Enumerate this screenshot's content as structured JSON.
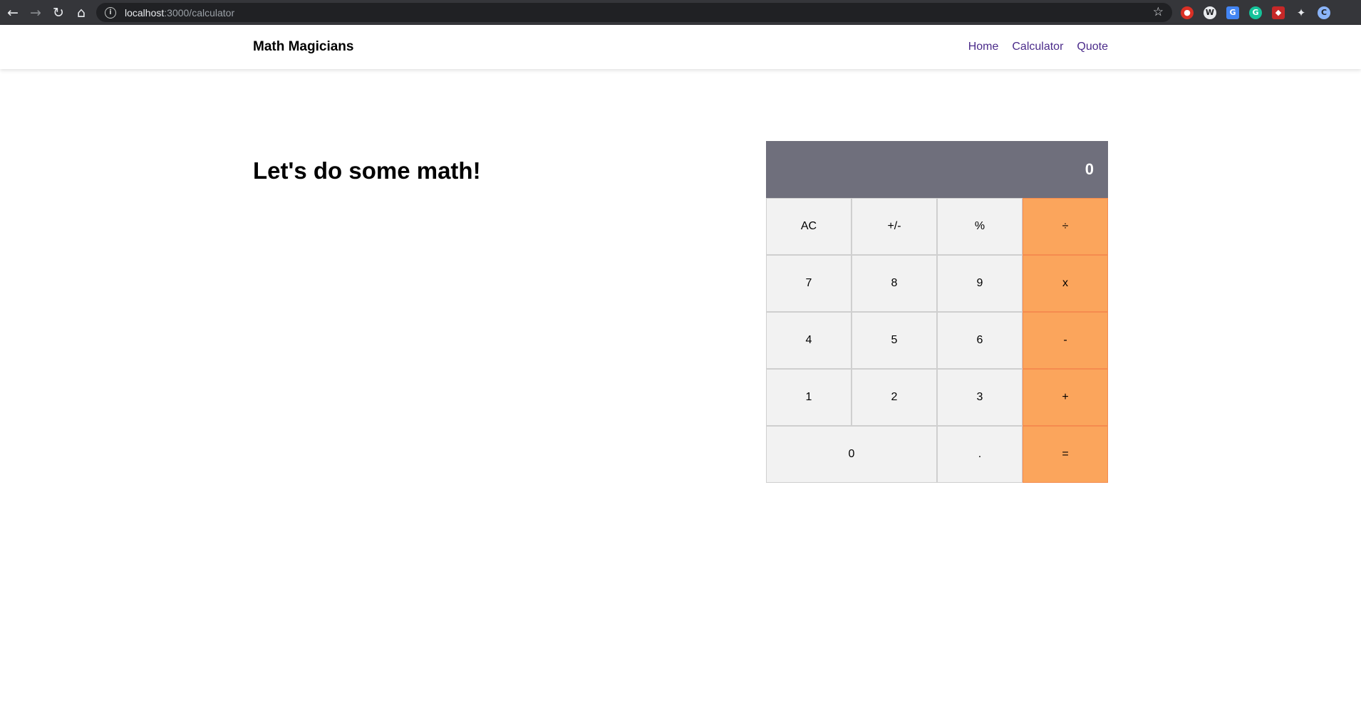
{
  "browser": {
    "url_host": "localhost",
    "url_path": ":3000/calculator"
  },
  "navbar": {
    "brand": "Math Magicians",
    "links": [
      "Home",
      "Calculator",
      "Quote"
    ]
  },
  "main": {
    "heading": "Let's do some math!"
  },
  "calculator": {
    "display": "0",
    "keys": [
      "AC",
      "+/-",
      "%",
      "÷",
      "7",
      "8",
      "9",
      "x",
      "4",
      "5",
      "6",
      "-",
      "1",
      "2",
      "3",
      "+",
      "0",
      ".",
      "="
    ]
  },
  "colors": {
    "display_bg": "#6f6f7c",
    "key_bg": "#f2f2f2",
    "operator_bg": "#fba55c",
    "nav_link": "#4b2b8a"
  }
}
